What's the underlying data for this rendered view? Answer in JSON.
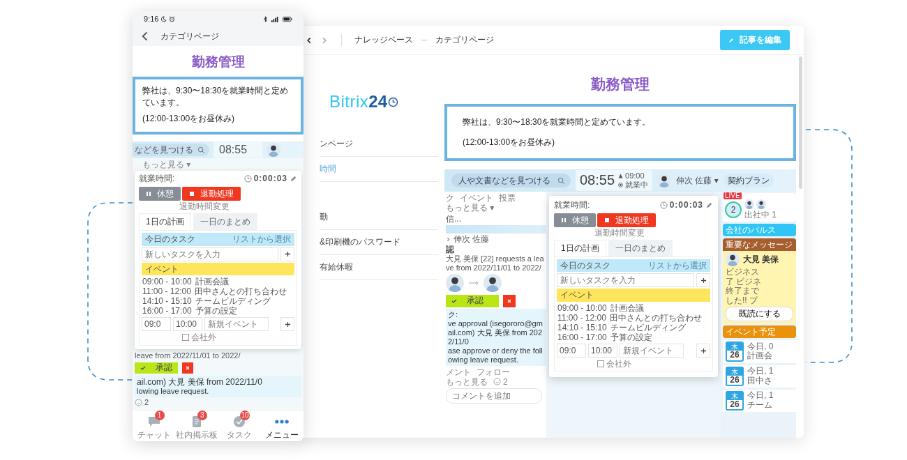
{
  "phone": {
    "status": {
      "time": "9:16"
    },
    "header": {
      "title": "カテゴリページ"
    },
    "article": {
      "title": "勤務管理",
      "lines": [
        "弊社は、9:30〜18:30を就業時間と定めています。",
        "(12:00-13:00をお昼休み)"
      ]
    },
    "portal": {
      "search": "などを見つける",
      "clock": "08:55",
      "more": "もっと見る ▾",
      "request": "leave from 2022/11/01 to 2022/",
      "approve": "承認",
      "lines": [
        "ail.com) 大見 美保 from 2022/11/0",
        "lowing leave request."
      ],
      "likes": "2",
      "popup": {
        "label": "就業時間:",
        "timer": "0:00:03",
        "pause": "休憩",
        "stop": "退勤処理",
        "change": "退勤時間変更",
        "tabs": [
          {
            "label": "1日の計画",
            "selected": true
          },
          {
            "label": "一日のまとめ",
            "selected": false
          }
        ],
        "tasks_title": "今日のタスク",
        "tasks_link": "リストから選択",
        "task_placeholder": "新しいタスクを入力",
        "events_title": "イベント",
        "events": [
          {
            "time": "09:00 - 10:00",
            "title": "計画会議"
          },
          {
            "time": "11:00 - 12:00",
            "title": "田中さんとの打ち合わせ"
          },
          {
            "time": "14:10 - 15:10",
            "title": "チームビルディング"
          },
          {
            "time": "16:00 - 17:00",
            "title": "予算の設定"
          }
        ],
        "new_event": {
          "start": "09:0",
          "end": "10:00",
          "placeholder": "新規イベント"
        },
        "outside": {
          "label": "会社外",
          "checked": false
        }
      }
    },
    "nav": [
      {
        "kind": "chat",
        "label": "チャット",
        "badge": "1",
        "selected": false
      },
      {
        "kind": "board",
        "label": "社内掲示板",
        "badge": "3",
        "selected": false
      },
      {
        "kind": "task",
        "label": "タスク",
        "badge": "10",
        "selected": false
      },
      {
        "kind": "menu",
        "label": "メニュー",
        "selected": true
      }
    ]
  },
  "desktop": {
    "breadcrumbs": [
      "ナレッジベース",
      "カテゴリページ"
    ],
    "edit_button": "記事を編集",
    "logo": {
      "word": "Bitrix",
      "number": "24"
    },
    "menu": [
      {
        "label": "ンページ",
        "selected": false
      },
      {
        "label": "時間",
        "selected": true
      },
      {
        "label": "勤",
        "selected": false
      },
      {
        "label": "&印刷機のパスワード",
        "selected": false
      },
      {
        "label": "有給休暇",
        "selected": false
      }
    ],
    "article": {
      "title": "勤務管理",
      "lines": [
        "弊社は、9:30〜18:30を就業時間と定めています。",
        "(12:00-13:00をお昼休み)"
      ]
    },
    "portal": {
      "search": "人や文書などを見つける",
      "clock": "08:55",
      "start": "09:00",
      "state": "就業中",
      "user": "伸次 佐藤 ▾",
      "plan": "契約プラン",
      "tabs": [
        "ク",
        "イベント",
        "投票",
        "もっと見る ▾"
      ],
      "feed_title": "信...",
      "author": "伸次 佐藤",
      "note": "認",
      "request": "大見 美保 [22] requests a leave from 2022/11/01 to 2022/",
      "approve": "承認",
      "task_lines": [
        "ク:",
        "ve approval (isegororo@gmail.com) 大見 美保 from 2022/11/0",
        "ase approve or deny the following leave request."
      ],
      "actions": [
        "メント",
        "フォロー",
        "もっと見る"
      ],
      "likes": "2",
      "comment_placeholder": "コメントを追加",
      "popup": {
        "label": "就業時間:",
        "timer": "0:00:03",
        "pause": "休憩",
        "stop": "退勤処理",
        "change": "退勤時間変更",
        "tabs": [
          {
            "label": "1日の計画",
            "selected": true
          },
          {
            "label": "一日のまとめ",
            "selected": false
          }
        ],
        "tasks_title": "今日のタスク",
        "tasks_link": "リストから選択",
        "task_placeholder": "新しいタスクを入力",
        "events_title": "イベント",
        "events": [
          {
            "time": "09:00 - 10:00",
            "title": "計画会議"
          },
          {
            "time": "11:00 - 12:00",
            "title": "田中さんとの打ち合わせ"
          },
          {
            "time": "14:10 - 15:10",
            "title": "チームビルディング"
          },
          {
            "time": "16:00 - 17:00",
            "title": "予算の設定"
          }
        ],
        "new_event": {
          "start": "09:0",
          "end": "10:00",
          "placeholder": "新規イベント"
        },
        "outside": {
          "label": "会社外",
          "checked": false
        }
      },
      "widgets": {
        "live": "LIVE",
        "count": "2",
        "present": "出社中 1",
        "pulse": "会社のパルス",
        "important": "重要なメッセージ",
        "sender": "大見 美保",
        "message": [
          "ビジネス",
          "了 ビジネ",
          "終了まで",
          "した!! プ"
        ],
        "read": "既読にする",
        "events_title": "イベント予定",
        "events": [
          {
            "day": "木",
            "date": "26",
            "time": "今日, 0",
            "title": "計画会"
          },
          {
            "day": "木",
            "date": "26",
            "time": "今日, 1",
            "title": "田中さ"
          },
          {
            "day": "木",
            "date": "26",
            "time": "今日, 1",
            "title": "チーム"
          }
        ]
      }
    }
  }
}
